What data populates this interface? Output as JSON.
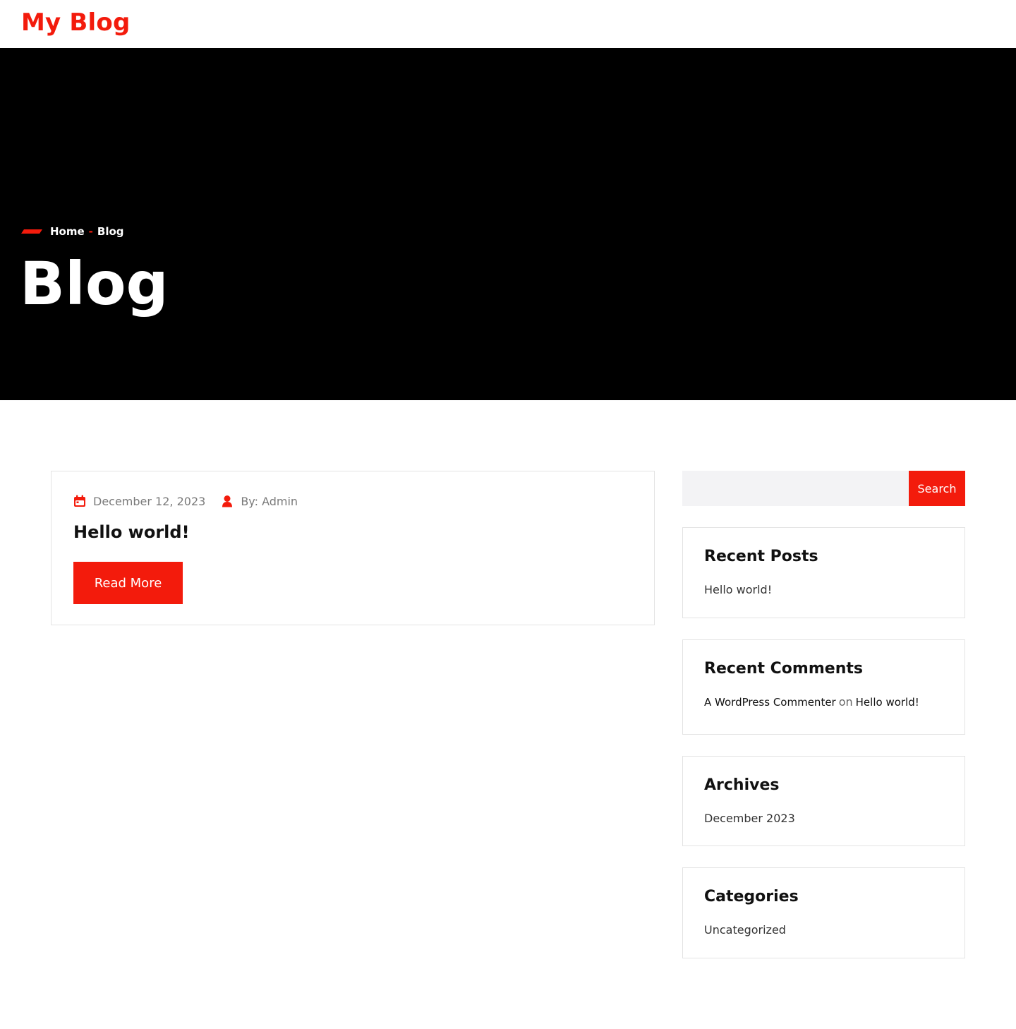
{
  "site": {
    "title": "My Blog"
  },
  "breadcrumb": {
    "home": "Home",
    "separator": "-",
    "current": "Blog"
  },
  "hero": {
    "title": "Blog"
  },
  "post": {
    "date": "December 12, 2023",
    "author": "By: Admin",
    "title": "Hello world!",
    "read_more": "Read More"
  },
  "search": {
    "button": "Search",
    "placeholder": ""
  },
  "widgets": {
    "recent_posts": {
      "title": "Recent Posts",
      "items": [
        "Hello world!"
      ]
    },
    "recent_comments": {
      "title": "Recent Comments",
      "author": "A WordPress Commenter",
      "on": "on",
      "post": "Hello world!"
    },
    "archives": {
      "title": "Archives",
      "items": [
        "December 2023"
      ]
    },
    "categories": {
      "title": "Categories",
      "items": [
        "Uncategorized"
      ]
    }
  },
  "colors": {
    "accent": "#f31b0c",
    "hero_bg": "#000000",
    "text": "#111111",
    "muted": "#7a7a7a"
  },
  "icons": {
    "date": "calendar-icon",
    "author": "user-icon",
    "breadcrumb": "slash-accent-icon"
  }
}
